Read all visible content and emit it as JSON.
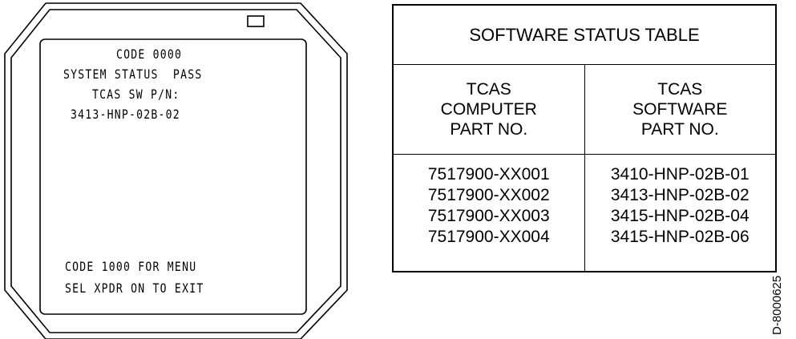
{
  "display": {
    "lines": [
      "CODE 0000",
      "SYSTEM STATUS  PASS",
      "TCAS SW P/N:",
      "3413-HNP-02B-02",
      "CODE 1000 FOR MENU",
      "SEL XPDR ON TO EXIT"
    ]
  },
  "table": {
    "title": "SOFTWARE STATUS TABLE",
    "headers": [
      "TCAS\nCOMPUTER\nPART NO.",
      "TCAS\nSOFTWARE\nPART NO."
    ],
    "rows": [
      [
        "7517900-XX001",
        "3410-HNP-02B-01"
      ],
      [
        "7517900-XX002",
        "3413-HNP-02B-02"
      ],
      [
        "7517900-XX003",
        "3415-HNP-02B-04"
      ],
      [
        "7517900-XX004",
        "3415-HNP-02B-06"
      ]
    ]
  },
  "doc_number": "D-8000625"
}
